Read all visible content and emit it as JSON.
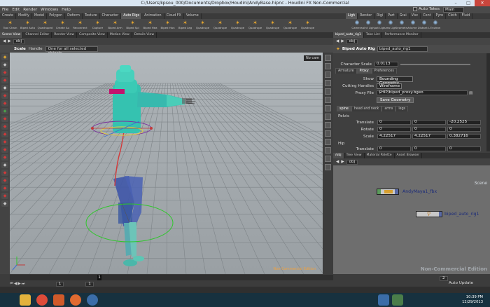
{
  "window": {
    "title": "C:/Users/kpsou_000/Documents/Dropbox/Houdini/AndyBase.hipnc - Houdini FX Non-Commercial",
    "min": "–",
    "max": "□",
    "close": "✕"
  },
  "menu": [
    "File",
    "Edit",
    "Render",
    "Windows",
    "Help"
  ],
  "topright": {
    "auto_takes": "Auto Takes",
    "desktop": "Main"
  },
  "shelf_tabs_left": [
    "Create",
    "Modify",
    "Model",
    "Polygon",
    "Deform",
    "Texture",
    "Character",
    "Auto Rigs",
    "Animation",
    "Cloud FX",
    "Volume"
  ],
  "shelf_tabs_right": [
    "Ligh",
    "Render",
    "Rigi",
    "Part",
    "Grai",
    "Visc",
    "Cont",
    "Pyro",
    "Cloth",
    "Fluid"
  ],
  "shelf_tools_left": [
    "Tool Chain",
    "Biped Auto",
    "Quadruped",
    "Create Au",
    "Reconnect",
    "Capture",
    "Biped Arm",
    "Biped Spl",
    "Biped Hea",
    "Biped Han",
    "Biped Leg",
    "Quadrupe",
    "Quadrupe",
    "Quadrupe",
    "Quadrupe",
    "Quadrupe",
    "Quadrupe",
    "Quadrupe"
  ],
  "shelf_tools_right": [
    "Camera",
    "Point Light",
    "Spot Light",
    "Area Light",
    "Geometry",
    "Volume L",
    "Distant Li",
    "Environ"
  ],
  "pane_tabs": [
    "Scene View",
    "Channel Editor",
    "Render View",
    "Composite View",
    "Motion View",
    "Details View"
  ],
  "viewer": {
    "path": "obj",
    "tool": "Scale",
    "handle": "Handle",
    "selection_mode": "One for all selected objects...",
    "camera": "No cam",
    "watermark": "Non-Commercial Edition"
  },
  "param_tabs": [
    "biped_auto_rig1",
    "Take List",
    "Performance Monitor"
  ],
  "params": {
    "path": "obj",
    "node_type": "Biped Auto Rig",
    "node_name": "biped_auto_rig1",
    "char_scale_label": "Character Scale",
    "char_scale": "0.0113",
    "tabs": [
      "Armature",
      "Proxy",
      "Preferences"
    ],
    "show_label": "Show",
    "show_value": "Bounding Geometry",
    "cutting_label": "Cutting Handles",
    "cutting_value": "Wireframe",
    "proxy_label": "Proxy File",
    "proxy_value": "$HIP/biped_proxy.bgeo",
    "save_btn": "Save Geometry",
    "part_tabs": [
      "spine",
      "head and neck",
      "arms",
      "legs"
    ],
    "section_pelvis": "Pelvis",
    "translate_label": "Translate",
    "translate": [
      "0",
      "0",
      "-20.2525"
    ],
    "rotate_label": "Rotate",
    "rotate": [
      "0",
      "0",
      "0"
    ],
    "scale_label": "Scale",
    "scale": [
      "4.22517",
      "4.22517",
      "0.382716"
    ],
    "section_hip": "Hip",
    "translate2_label": "Translate",
    "translate2": [
      "0",
      "0",
      "0"
    ]
  },
  "network_tabs": [
    "/obj",
    "Tree View",
    "Material Palette",
    "Asset Browser"
  ],
  "network": {
    "path": "obj",
    "context": "Scene",
    "watermark": "Non-Commercial Edition",
    "nodes": [
      {
        "name": "AndyMaya1_fbx"
      },
      {
        "name": "biped_auto_rig1"
      }
    ]
  },
  "timeline": {
    "current_frame": "1",
    "frame_start": "1",
    "frame_end": "1",
    "playback": "2",
    "auto_update": "Auto Update"
  },
  "clock": {
    "time": "10:39 PM",
    "date": "12/29/2013"
  }
}
